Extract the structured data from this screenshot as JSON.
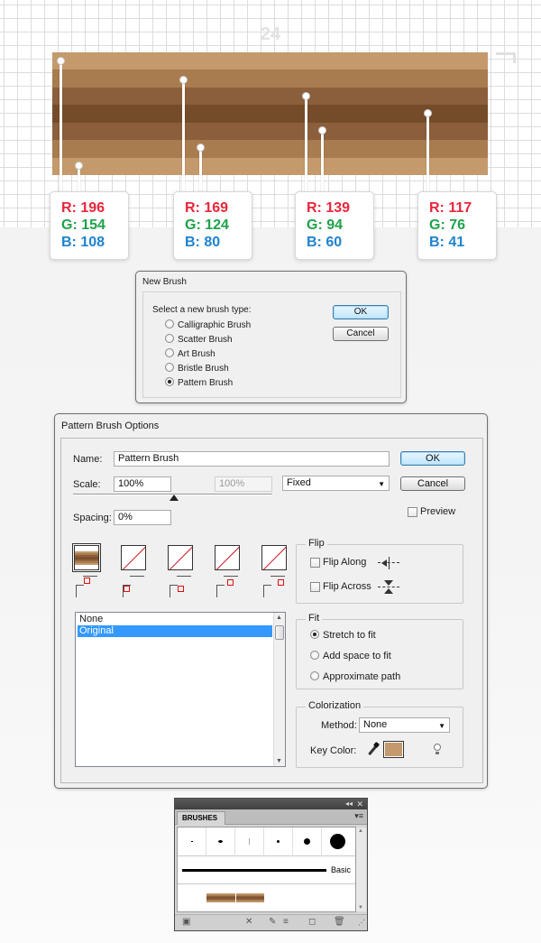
{
  "artboard": {
    "step_number": "24",
    "stripes": [
      {
        "color": "#c49a6c"
      },
      {
        "color": "#a97c50"
      },
      {
        "color": "#8b5e3c"
      },
      {
        "color": "#754c29"
      },
      {
        "color": "#8b5e3c"
      },
      {
        "color": "#a97c50"
      },
      {
        "color": "#c49a6c"
      }
    ],
    "swatches": [
      {
        "r": "R: 196",
        "g": "G: 154",
        "b": "B: 108"
      },
      {
        "r": "R: 169",
        "g": "G: 124",
        "b": "B: 80"
      },
      {
        "r": "R: 139",
        "g": "G: 94",
        "b": "B: 60"
      },
      {
        "r": "R: 117",
        "g": "G: 76",
        "b": "B: 41"
      }
    ],
    "label_colors": {
      "r": "#e8263b",
      "g": "#1fa24a",
      "b": "#1e82cf"
    }
  },
  "new_brush": {
    "title": "New Brush",
    "prompt": "Select a new brush type:",
    "options": [
      "Calligraphic Brush",
      "Scatter Brush",
      "Art Brush",
      "Bristle Brush",
      "Pattern Brush"
    ],
    "selected": "Pattern Brush",
    "ok_label": "OK",
    "cancel_label": "Cancel"
  },
  "pattern_options": {
    "title": "Pattern Brush Options",
    "name_label": "Name:",
    "name_value": "Pattern Brush",
    "scale_label": "Scale:",
    "scale_value": "100%",
    "scale_max_value": "100%",
    "scale_mode": "Fixed",
    "spacing_label": "Spacing:",
    "spacing_value": "0%",
    "ok_label": "OK",
    "cancel_label": "Cancel",
    "preview_label": "Preview",
    "tile_list": [
      "None",
      "Original"
    ],
    "tile_list_selected": "Original",
    "flip": {
      "title": "Flip",
      "along_label": "Flip Along",
      "across_label": "Flip Across"
    },
    "fit": {
      "title": "Fit",
      "options": [
        "Stretch to fit",
        "Add space to fit",
        "Approximate path"
      ],
      "selected": "Stretch to fit"
    },
    "colorization": {
      "title": "Colorization",
      "method_label": "Method:",
      "method_value": "None",
      "key_color_label": "Key Color:",
      "key_color": "#c49a6c"
    }
  },
  "brushes_panel": {
    "tab_label": "BRUSHES",
    "basic_label": "Basic"
  }
}
